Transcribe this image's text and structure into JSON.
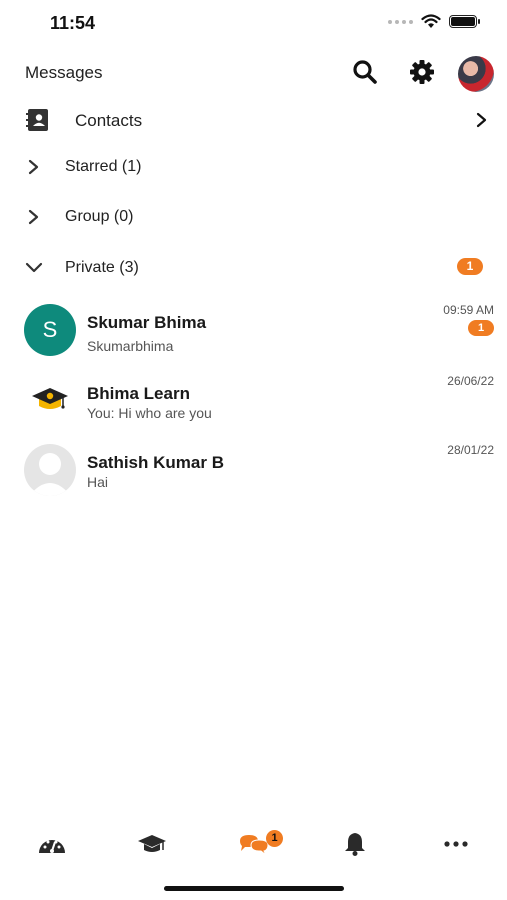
{
  "status_bar": {
    "time": "11:54"
  },
  "header": {
    "title": "Messages",
    "search_icon": "search-icon",
    "settings_icon": "gear-icon"
  },
  "contacts": {
    "label": "Contacts"
  },
  "sections": [
    {
      "label": "Starred (1)",
      "expanded": false
    },
    {
      "label": "Group (0)",
      "expanded": false
    },
    {
      "label": "Private (3)",
      "expanded": true,
      "badge": "1"
    }
  ],
  "chats": [
    {
      "name": "Skumar Bhima",
      "preview": "Skumarbhima",
      "time": "09:59 AM",
      "unread": "1",
      "avatar_letter": "S"
    },
    {
      "name": "Bhima Learn",
      "preview": "You: Hi who are you",
      "time": "26/06/22"
    },
    {
      "name": "Sathish Kumar B",
      "preview": "Hai",
      "time": "28/01/22"
    }
  ],
  "tabbar": {
    "tabs": [
      "dashboard-icon",
      "courses-icon",
      "messages-icon",
      "notifications-icon",
      "more-icon"
    ],
    "active": "messages-icon",
    "messages_badge": "1"
  },
  "colors": {
    "accent": "#f07c22",
    "avatar_teal": "#0e8a7c"
  }
}
